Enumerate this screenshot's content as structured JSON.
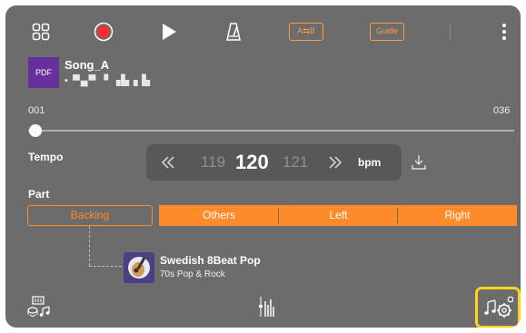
{
  "toolbar": {
    "menu_icon": "grid-icon",
    "record_icon": "record-icon",
    "play_icon": "play-icon",
    "metronome_icon": "metronome-icon",
    "ab_label": "A⇆B",
    "guide_label": "Guide",
    "more_icon": "more-vertical-icon"
  },
  "song": {
    "icon_label": "PDF",
    "title": "Song_A",
    "subtitle": "▪ ▀▄▀ ▝ ▗▙▗ ▙"
  },
  "position": {
    "start": "001",
    "end": "036",
    "progress_fraction": 0.0
  },
  "tempo": {
    "label": "Tempo",
    "prev": "119",
    "current": "120",
    "next": "121",
    "unit": "bpm",
    "decrease_icon": "rewind-icon",
    "increase_icon": "fast-forward-icon",
    "download_icon": "download-icon"
  },
  "part": {
    "label": "Part",
    "buttons": [
      "Backing",
      "Others",
      "Left",
      "Right"
    ]
  },
  "style": {
    "name": "Swedish 8Beat Pop",
    "category": "70s Pop & Rock"
  },
  "bottom": {
    "left_icon": "style-score-icon",
    "center_icon": "mixer-icon",
    "right_icon": "music-settings-icon"
  },
  "colors": {
    "panel": "#6c6c6c",
    "accent": "#ff8a2a",
    "record": "#ff2b2b",
    "highlight": "#ffd21e"
  }
}
